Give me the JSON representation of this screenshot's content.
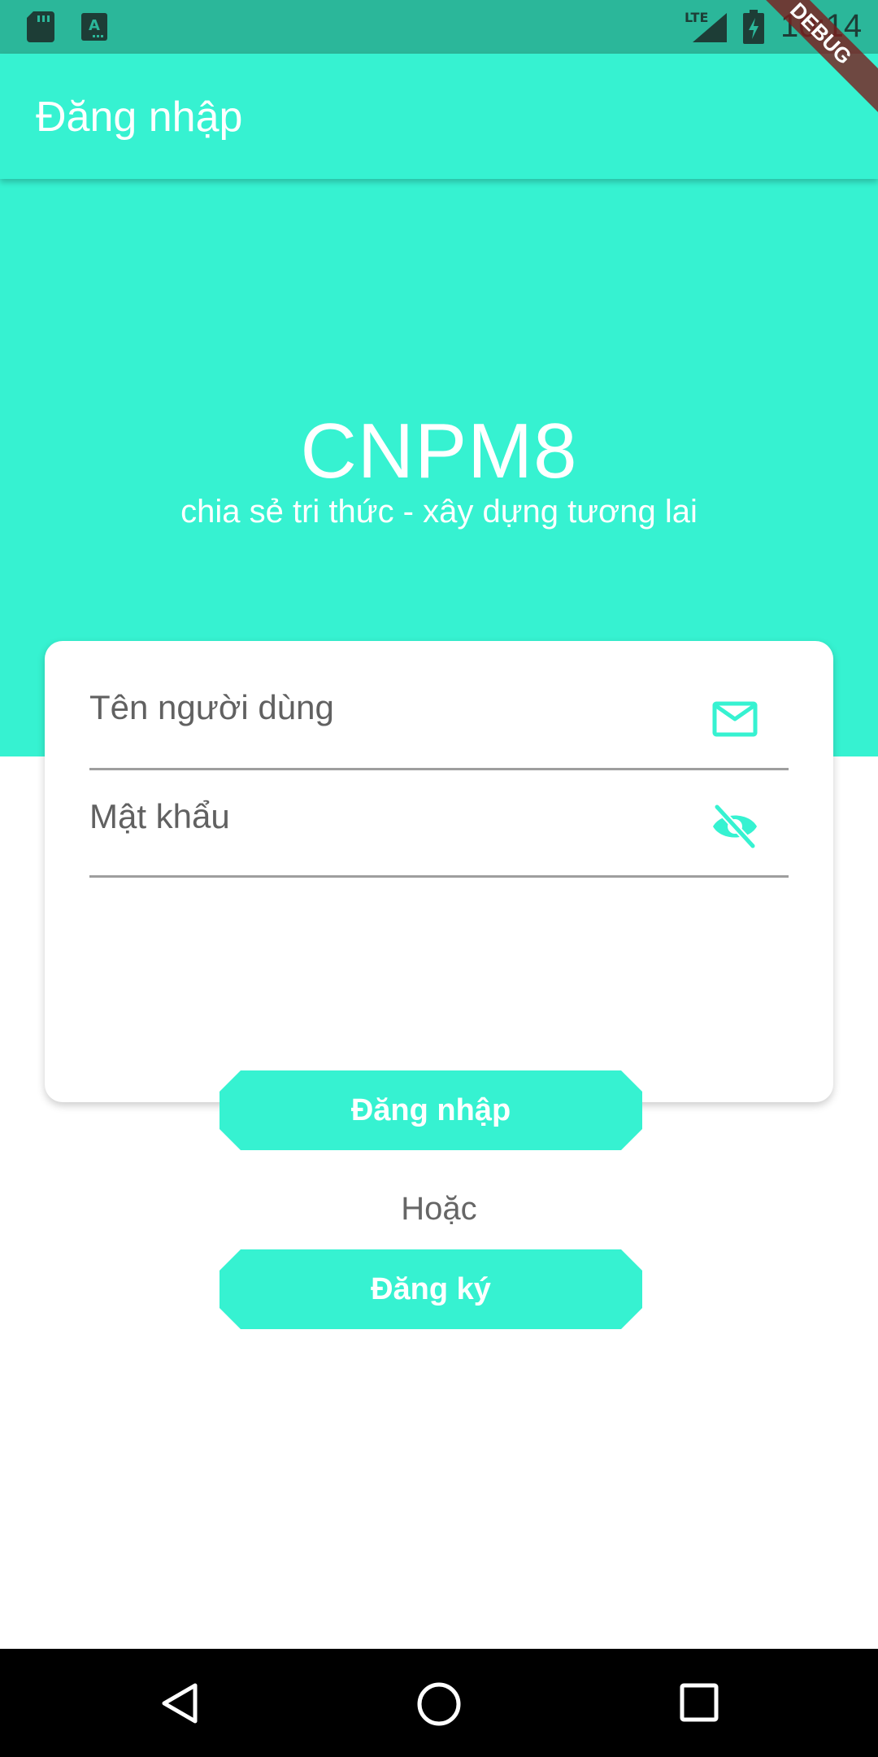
{
  "status_bar": {
    "time": "10:14",
    "network": "LTE",
    "icons": [
      "sd-card-icon",
      "keyboard-a-icon",
      "signal-icon",
      "battery-charging-icon"
    ]
  },
  "debug_banner": "DEBUG",
  "app_bar": {
    "title": "Đăng nhập"
  },
  "hero": {
    "title": "CNPM8",
    "tagline": "chia sẻ tri thức - xây dựng tương lai"
  },
  "form": {
    "username_label": "Tên người dùng",
    "username_icon": "mail-icon",
    "password_label": "Mật khẩu",
    "password_icon": "eye-off-icon"
  },
  "actions": {
    "login_label": "Đăng nhập",
    "or_label": "Hoặc",
    "register_label": "Đăng ký"
  },
  "nav_bar": {
    "icons": [
      "back-icon",
      "home-icon",
      "recents-icon"
    ]
  },
  "colors": {
    "accent": "#36f2d1",
    "status_bar": "#2bb79a",
    "debug": "#7d1d1d"
  }
}
